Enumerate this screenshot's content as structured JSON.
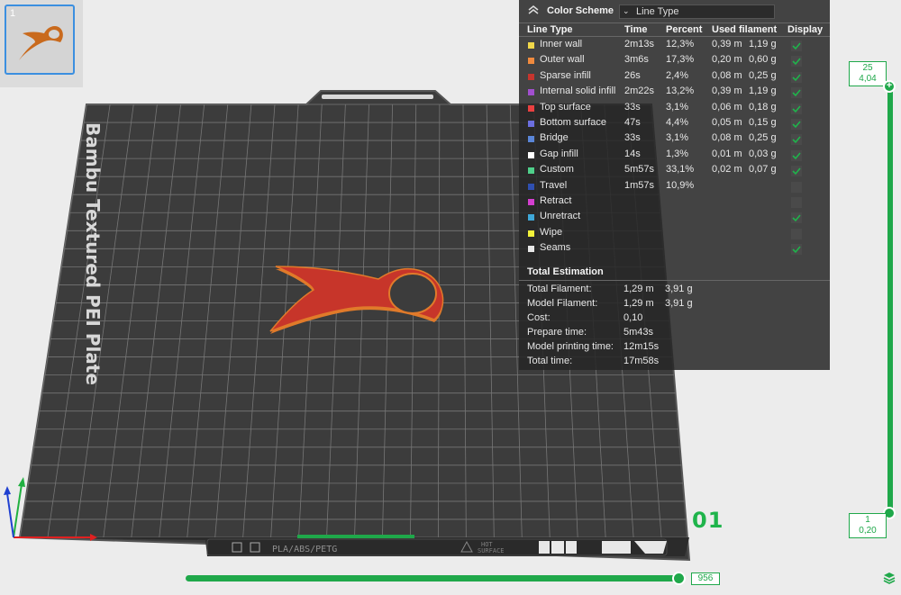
{
  "plate_thumbnail": {
    "index": "1"
  },
  "bed": {
    "label": "Bambu Textured PEI Plate",
    "material_tag": "PLA/ABS/PETG",
    "hot_tag_line1": "HOT",
    "hot_tag_line2": "SURFACE",
    "plate_number": "01"
  },
  "legend": {
    "title": "Color Scheme",
    "scheme_value": "Line Type",
    "columns": [
      "Line Type",
      "Time",
      "Percent",
      "Used filament",
      "Display"
    ],
    "rows": [
      {
        "name": "Inner wall",
        "time": "2m13s",
        "percent": "12,3%",
        "length": "0,39 m",
        "weight": "1,19 g",
        "color": "#f1d84a",
        "display": true
      },
      {
        "name": "Outer wall",
        "time": "3m6s",
        "percent": "17,3%",
        "length": "0,20 m",
        "weight": "0,60 g",
        "color": "#f08a3e",
        "display": true
      },
      {
        "name": "Sparse infill",
        "time": "26s",
        "percent": "2,4%",
        "length": "0,08 m",
        "weight": "0,25 g",
        "color": "#c6352e",
        "display": true
      },
      {
        "name": "Internal solid infill",
        "time": "2m22s",
        "percent": "13,2%",
        "length": "0,39 m",
        "weight": "1,19 g",
        "color": "#a24fcf",
        "display": true
      },
      {
        "name": "Top surface",
        "time": "33s",
        "percent": "3,1%",
        "length": "0,06 m",
        "weight": "0,18 g",
        "color": "#ea4040",
        "display": true
      },
      {
        "name": "Bottom surface",
        "time": "47s",
        "percent": "4,4%",
        "length": "0,05 m",
        "weight": "0,15 g",
        "color": "#6c6fe0",
        "display": true
      },
      {
        "name": "Bridge",
        "time": "33s",
        "percent": "3,1%",
        "length": "0,08 m",
        "weight": "0,25 g",
        "color": "#5a86d8",
        "display": true
      },
      {
        "name": "Gap infill",
        "time": "14s",
        "percent": "1,3%",
        "length": "0,01 m",
        "weight": "0,03 g",
        "color": "#ffffff",
        "display": true
      },
      {
        "name": "Custom",
        "time": "5m57s",
        "percent": "33,1%",
        "length": "0,02 m",
        "weight": "0,07 g",
        "color": "#4fcf8a",
        "display": true
      },
      {
        "name": "Travel",
        "time": "1m57s",
        "percent": "10,9%",
        "length": "",
        "weight": "",
        "color": "#2f4fb0",
        "display": false
      },
      {
        "name": "Retract",
        "time": "",
        "percent": "",
        "length": "",
        "weight": "",
        "color": "#d43fd0",
        "display": false
      },
      {
        "name": "Unretract",
        "time": "",
        "percent": "",
        "length": "",
        "weight": "",
        "color": "#3fa8d8",
        "display": true
      },
      {
        "name": "Wipe",
        "time": "",
        "percent": "",
        "length": "",
        "weight": "",
        "color": "#f2f23a",
        "display": false
      },
      {
        "name": "Seams",
        "time": "",
        "percent": "",
        "length": "",
        "weight": "",
        "color": "#e8e8e8",
        "display": true
      }
    ],
    "estimation_title": "Total Estimation",
    "estimation": [
      {
        "label": "Total Filament:",
        "v1": "1,29 m",
        "v2": "3,91 g"
      },
      {
        "label": "Model Filament:",
        "v1": "1,29 m",
        "v2": "3,91 g"
      },
      {
        "label": "Cost:",
        "v1": "0,10",
        "v2": ""
      },
      {
        "label": "Prepare time:",
        "v1": "5m43s",
        "v2": ""
      },
      {
        "label": "Model printing time:",
        "v1": "12m15s",
        "v2": ""
      },
      {
        "label": "Total time:",
        "v1": "17m58s",
        "v2": ""
      }
    ]
  },
  "layer_slider": {
    "top_layer": "25",
    "top_height": "4,04",
    "bottom_layer": "1",
    "bottom_height": "0,20"
  },
  "move_slider": {
    "value": "956"
  },
  "colors": {
    "accent": "#1fa84a",
    "model": "#c7352a",
    "model_edge": "#e07a2a"
  }
}
